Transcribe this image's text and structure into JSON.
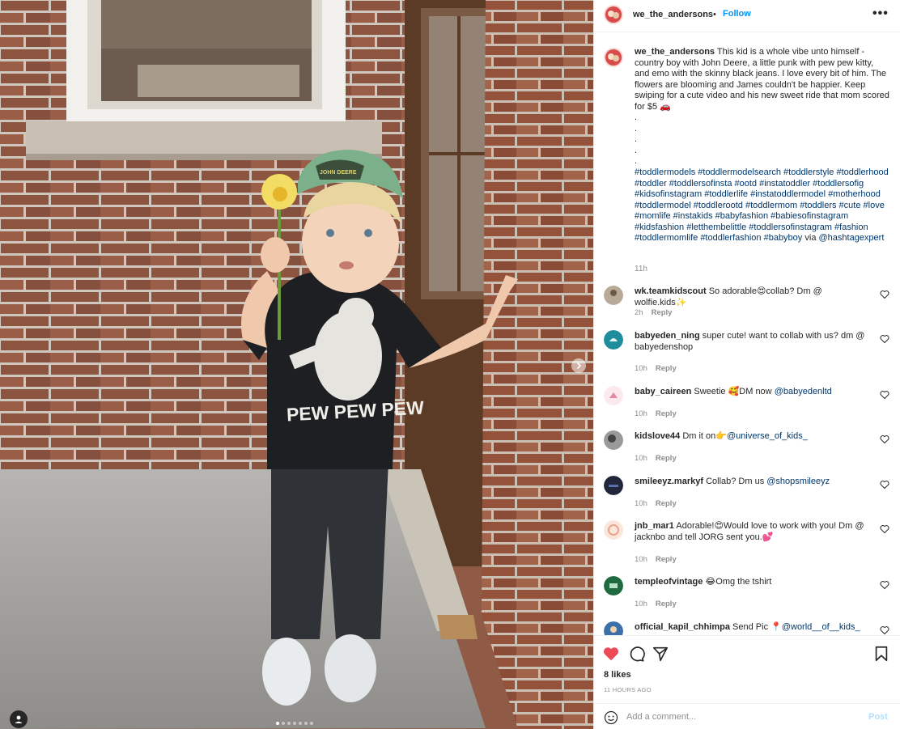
{
  "post": {
    "username": "we_the_andersons",
    "separator": "•",
    "follow_label": "Follow",
    "more_label": "•••",
    "caption_text": "This kid is a whole vibe unto himself - country boy with John Deere, a little punk with pew pew kitty, and emo with the skinny black jeans. I love every bit of him. The flowers are blooming and James couldn't be happier. Keep swiping for a cute video and his new sweet ride that mom scored for $5 🚗\n.\n.\n.\n.\n.",
    "hashtags": "#toddlermodels #toddlermodelsearch #toddlerstyle #toddlerhood #toddler #toddlersofinsta #ootd #instatoddler #toddlersofig #kidsofinstagram #toddlerlife #instatoddlermodel #motherhood #toddlermodel #toddlerootd #toddlermom #toddlers #cute #love #momlife #instakids #babyfashion #babiesofinstagram #kidsfashion #letthembelittle #toddlersofinstagram #fashion #toddlermomlife #toddlerfashion #babyboy",
    "via_label": " via ",
    "via_handle": "@hashtagexpert",
    "caption_time": "11h"
  },
  "comments": [
    {
      "user": "wk.teamkidscout",
      "text": "So adorable😍collab? Dm @ wolfie.kids✨",
      "mention": "",
      "time": "2h",
      "reply": "Reply"
    },
    {
      "user": "babyeden_ning",
      "text": "super cute! want to collab with us? dm @ babyedenshop",
      "mention": "",
      "time": "10h",
      "reply": "Reply"
    },
    {
      "user": "baby_caireen",
      "text": "Sweetie 🥰DM now ",
      "mention": "@babyedenltd",
      "time": "10h",
      "reply": "Reply"
    },
    {
      "user": "kidslove44",
      "text": "Dm it on👉",
      "mention": "@universe_of_kids_",
      "time": "10h",
      "reply": "Reply"
    },
    {
      "user": "smileeyz.markyf",
      "text": "Collab? Dm us ",
      "mention": "@shopsmileeyz",
      "time": "10h",
      "reply": "Reply"
    },
    {
      "user": "jnb_mar1",
      "text": "Adorable!😍Would love to work with you! Dm @ jacknbo and tell JORG sent you.💕",
      "mention": "",
      "time": "10h",
      "reply": "Reply"
    },
    {
      "user": "templeofvintage",
      "text": "😂Omg the tshirt",
      "mention": "",
      "time": "10h",
      "reply": "Reply"
    },
    {
      "user": "official_kapil_chhimpa",
      "text": "Send Pic 📍",
      "mention": "@world__of__kids_",
      "time": "",
      "reply": ""
    }
  ],
  "footer": {
    "likes": "8 likes",
    "timestamp": "11 HOURS AGO",
    "comment_placeholder": "Add a comment...",
    "post_label": "Post"
  },
  "photo": {
    "cap_text": "JOHN DEERE",
    "shirt_text": "PEW PEW PEW"
  },
  "icons": {
    "like": "heart-filled-icon",
    "comment": "comment-bubble-icon",
    "share": "paper-plane-icon",
    "save": "bookmark-icon",
    "emoji": "smiley-icon",
    "next": "chevron-right-icon",
    "tag": "user-tag-icon"
  },
  "colors": {
    "like_red": "#ed4956",
    "follow_blue": "#0095f6",
    "hashtag_blue": "#00376b",
    "muted_gray": "#8e8e8e",
    "post_disabled": "#b2dffc"
  }
}
